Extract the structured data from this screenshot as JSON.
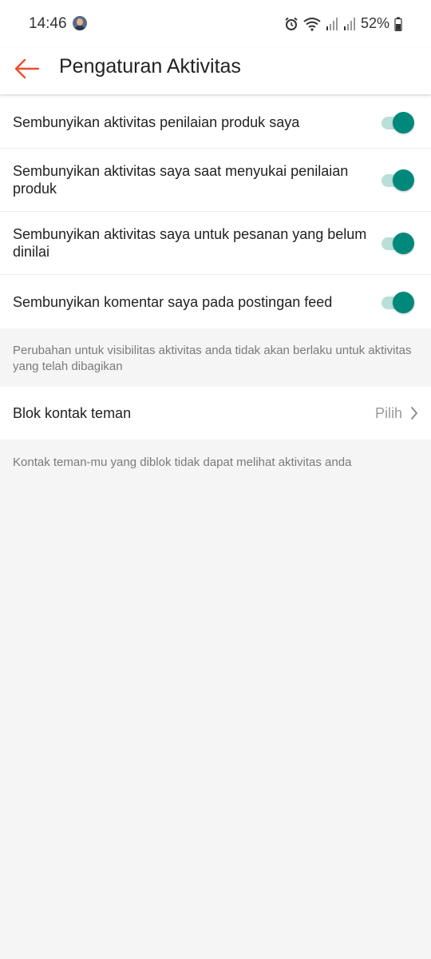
{
  "status_bar": {
    "time": "14:46",
    "battery": "52%",
    "icons": [
      "alarm-icon",
      "wifi-icon",
      "signal-icon",
      "signal-icon",
      "battery-icon"
    ]
  },
  "header": {
    "title": "Pengaturan Aktivitas",
    "back_icon": "arrow-left-icon",
    "accent_color": "#ee4d2d"
  },
  "toggles": [
    {
      "label": "Sembunyikan aktivitas penilaian produk saya",
      "on": true
    },
    {
      "label": "Sembunyikan aktivitas saya saat menyukai penilaian produk",
      "on": true
    },
    {
      "label": "Sembunyikan aktivitas saya untuk pesanan yang belum dinilai",
      "on": true
    },
    {
      "label": "Sembunyikan komentar saya pada postingan feed",
      "on": true
    }
  ],
  "toggle_color": "#00897b",
  "visibility_note": "Perubahan untuk visibilitas aktivitas anda tidak akan berlaku untuk aktivitas yang telah dibagikan",
  "block_contacts": {
    "label": "Blok kontak teman",
    "value": "Pilih",
    "icon": "chevron-right-icon"
  },
  "block_note": "Kontak teman-mu yang diblok tidak dapat melihat aktivitas anda"
}
